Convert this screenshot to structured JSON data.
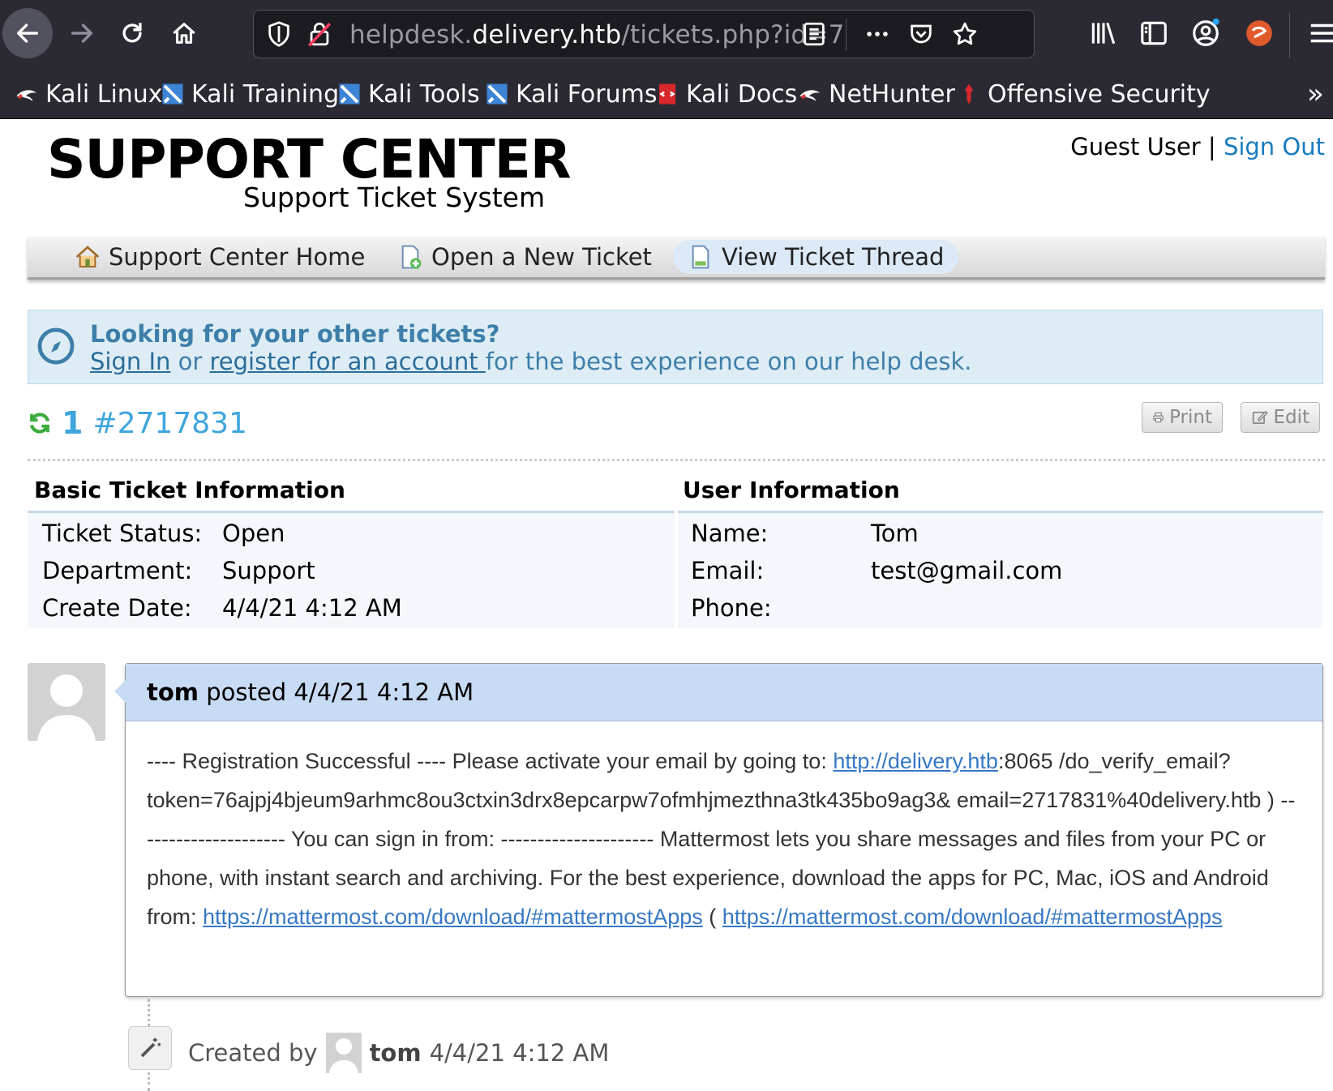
{
  "browser": {
    "url_prefix": "helpdesk.",
    "url_host": "delivery.htb",
    "url_path": "/tickets.php?id=7",
    "bookmarks": [
      {
        "label": "Kali Linux",
        "icon": "kali-dragon-icon"
      },
      {
        "label": "Kali Training",
        "icon": "kali-sword-icon"
      },
      {
        "label": "Kali Tools",
        "icon": "kali-sword-icon"
      },
      {
        "label": "Kali Forums",
        "icon": "kali-sword-icon"
      },
      {
        "label": "Kali Docs",
        "icon": "kali-docs-icon"
      },
      {
        "label": "NetHunter",
        "icon": "kali-dragon-icon"
      },
      {
        "label": "Offensive Security",
        "icon": "offsec-icon"
      }
    ],
    "overflow_label": "»"
  },
  "header": {
    "logo_title": "SUPPORT CENTER",
    "logo_subtitle": "Support Ticket System",
    "user_label": "Guest User",
    "separator": " | ",
    "signout_label": "Sign Out"
  },
  "nav": {
    "home": "Support Center Home",
    "new_ticket": "Open a New Ticket",
    "view_thread": "View Ticket Thread"
  },
  "notice": {
    "title": "Looking for your other tickets?",
    "signin_link": "Sign In",
    "or_text": " or ",
    "register_link": "register for an account ",
    "rest": "for the best experience on our help desk."
  },
  "ticket": {
    "number": "1",
    "id": "#2717831",
    "print_label": "Print",
    "edit_label": "Edit"
  },
  "basic_info": {
    "title": "Basic Ticket Information",
    "status_label": "Ticket Status:",
    "status_value": "Open",
    "dept_label": "Department:",
    "dept_value": "Support",
    "date_label": "Create Date:",
    "date_value": "4/4/21 4:12 AM"
  },
  "user_info": {
    "title": "User Information",
    "name_label": "Name:",
    "name_value": "Tom",
    "email_label": "Email:",
    "email_value": "test@gmail.com",
    "phone_label": "Phone:",
    "phone_value": ""
  },
  "post": {
    "author": "tom",
    "posted_text": " posted ",
    "date": "4/4/21 4:12 AM",
    "body_1": "---- Registration Successful ---- Please activate your email by going to: ",
    "link_1": "http://delivery.htb",
    "body_2": ":8065 /do_verify_email?token=76ajpj4bjeum9arhmc8ou3ctxin3drx8epcarpw7ofmhjmezthna3tk435bo9ag3& email=2717831%40delivery.htb ) --------------------- You can sign in from: --------------------- Mattermost lets you share messages and files from your PC or phone, with instant search and archiving. For the best experience, download the apps for PC, Mac, iOS and Android from: ",
    "link_2": "https://mattermost.com/download/#mattermostApps",
    "body_3": " ( ",
    "link_3": "https://mattermost.com/download/#mattermostApps"
  },
  "event": {
    "created_by": "Created by",
    "author": "tom",
    "date": "4/4/21 4:12 AM"
  }
}
